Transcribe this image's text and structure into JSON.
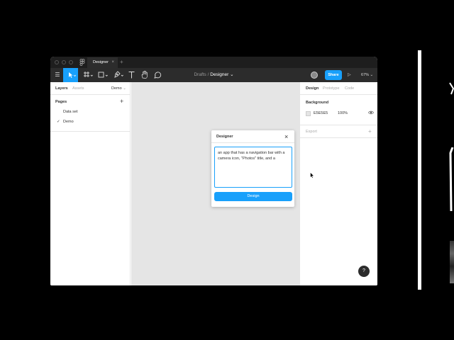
{
  "titlebar": {
    "tab_title": "Designer",
    "tab_close": "×",
    "new_tab": "+"
  },
  "toolbar": {
    "menu_glyph": "☰",
    "breadcrumb_project": "Drafts",
    "breadcrumb_separator": "/",
    "breadcrumb_file": "Designer",
    "breadcrumb_chevron": "⌄",
    "share_label": "Share",
    "play_glyph": "▷",
    "zoom_label": "67%",
    "zoom_chevron": "⌄"
  },
  "left_panel": {
    "tab_layers": "Layers",
    "tab_assets": "Assets",
    "page_selector": "Demo",
    "page_selector_chevron": "⌄",
    "pages_title": "Pages",
    "add_page": "+",
    "pages": [
      {
        "label": "Data set",
        "checked": false
      },
      {
        "label": "Demo",
        "checked": true
      }
    ],
    "check_glyph": "✓"
  },
  "dialog": {
    "title": "Designer",
    "close_glyph": "×",
    "prompt_value": "an app that has a navigation bar with a camera icon, \"Photos\" title, and a",
    "button_label": "Design"
  },
  "right_panel": {
    "tab_design": "Design",
    "tab_prototype": "Prototype",
    "tab_code": "Code",
    "background_title": "Background",
    "background_hex": "E5E5E5",
    "background_opacity": "100%",
    "export_title": "Export",
    "export_add": "+",
    "help_label": "?"
  },
  "colors": {
    "accent": "#18a0fb",
    "toolbar_bg": "#2c2c2c",
    "canvas_bg": "#e5e5e5"
  }
}
